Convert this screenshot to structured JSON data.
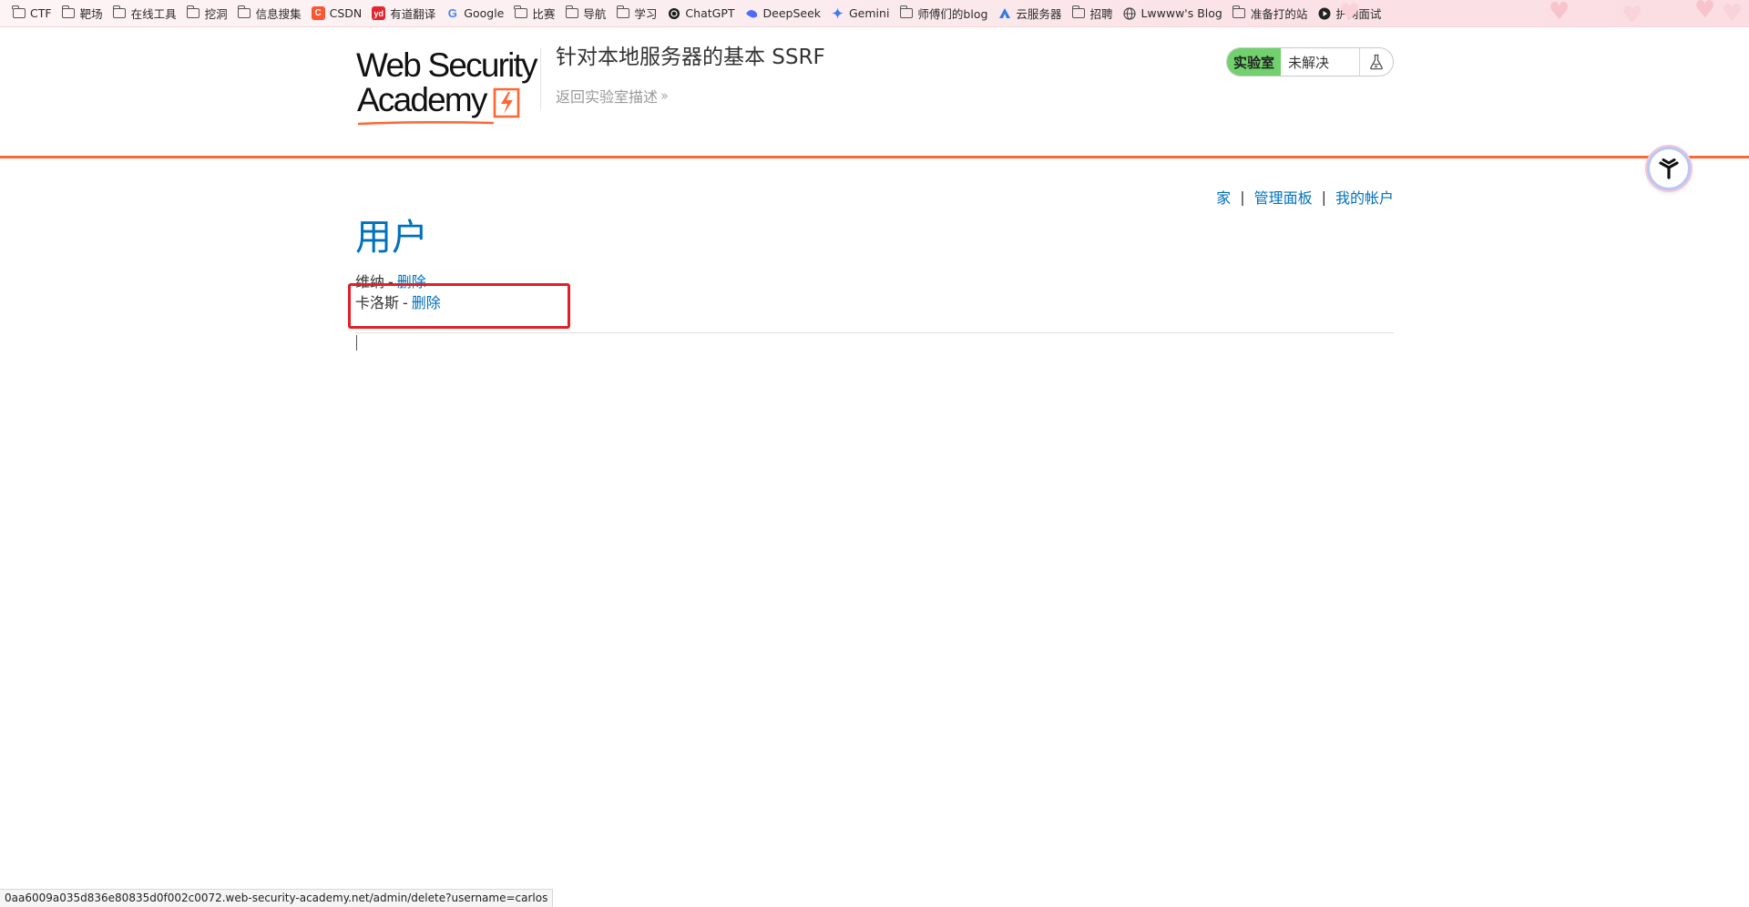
{
  "bookmarks": [
    {
      "label": "CTF",
      "icon": "folder-icon"
    },
    {
      "label": "靶场",
      "icon": "folder-icon"
    },
    {
      "label": "在线工具",
      "icon": "folder-icon"
    },
    {
      "label": "挖洞",
      "icon": "folder-icon"
    },
    {
      "label": "信息搜集",
      "icon": "folder-icon"
    },
    {
      "label": "CSDN",
      "icon": "csdn-icon"
    },
    {
      "label": "有道翻译",
      "icon": "youdao-icon"
    },
    {
      "label": "Google",
      "icon": "google-icon"
    },
    {
      "label": "比赛",
      "icon": "folder-icon"
    },
    {
      "label": "导航",
      "icon": "folder-icon"
    },
    {
      "label": "学习",
      "icon": "folder-icon"
    },
    {
      "label": "ChatGPT",
      "icon": "chatgpt-icon"
    },
    {
      "label": "DeepSeek",
      "icon": "deepseek-icon"
    },
    {
      "label": "Gemini",
      "icon": "gemini-icon"
    },
    {
      "label": "师傅们的blog",
      "icon": "folder-icon"
    },
    {
      "label": "云服务器",
      "icon": "cloud-icon"
    },
    {
      "label": "招聘",
      "icon": "folder-icon"
    },
    {
      "label": "Lwwww's Blog",
      "icon": "globe-icon"
    },
    {
      "label": "准备打的站",
      "icon": "folder-icon"
    },
    {
      "label": "护网面试",
      "icon": "play-icon"
    }
  ],
  "header": {
    "logo_line1": "Web Security",
    "logo_line2": "Academy",
    "lab_title": "针对本地服务器的基本 SSRF",
    "back_link": "返回实验室描述",
    "status_label": "实验室",
    "status_value": "未解决"
  },
  "nav": {
    "home": "家",
    "admin_panel": "管理面板",
    "my_account": "我的帐户",
    "separator": "|"
  },
  "main": {
    "heading": "用户",
    "users": [
      {
        "name": "维纳",
        "separator": "-",
        "action": "删除"
      },
      {
        "name": "卡洛斯",
        "separator": "-",
        "action": "删除"
      }
    ]
  },
  "statusbar": {
    "url": "0aa6009a035d836e80835d0f002c0072.web-security-academy.net/admin/delete?username=carlos"
  },
  "colors": {
    "accent_orange": "#ff6633",
    "link_blue": "#0071bc",
    "lab_green": "#70d16d",
    "highlight_red": "#e41e26"
  }
}
